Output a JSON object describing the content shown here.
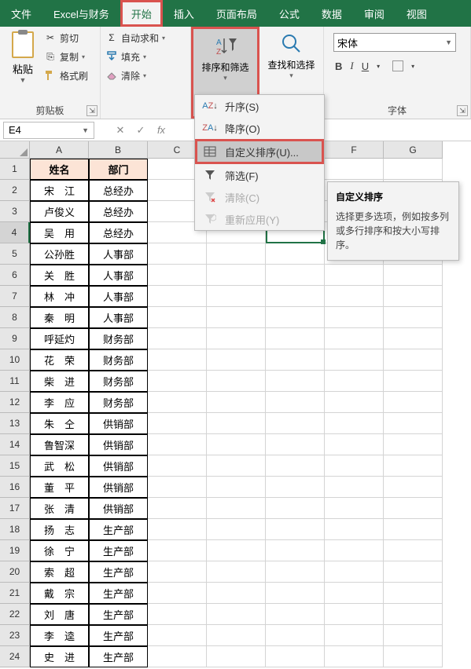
{
  "menubar": {
    "items": [
      "文件",
      "Excel与财务",
      "开始",
      "插入",
      "页面布局",
      "公式",
      "数据",
      "审阅",
      "视图"
    ],
    "active_index": 2
  },
  "ribbon": {
    "clipboard": {
      "paste": "粘贴",
      "cut": "剪切",
      "copy": "复制",
      "format_painter": "格式刷",
      "group_label": "剪贴板"
    },
    "editing": {
      "autosum": "自动求和",
      "fill": "填充",
      "clear": "清除"
    },
    "sort": {
      "label": "排序和筛选"
    },
    "find": {
      "label": "查找和选择"
    },
    "font": {
      "name": "宋体",
      "group_label": "字体",
      "bold": "B",
      "italic": "I",
      "underline": "U"
    }
  },
  "formula_bar": {
    "cell_ref": "E4"
  },
  "columns": [
    "A",
    "B",
    "C",
    "D",
    "E",
    "F",
    "G"
  ],
  "table": {
    "headers": [
      "姓名",
      "部门"
    ],
    "rows": [
      [
        "宋　江",
        "总经办"
      ],
      [
        "卢俊义",
        "总经办"
      ],
      [
        "吴　用",
        "总经办"
      ],
      [
        "公孙胜",
        "人事部"
      ],
      [
        "关　胜",
        "人事部"
      ],
      [
        "林　冲",
        "人事部"
      ],
      [
        "秦　明",
        "人事部"
      ],
      [
        "呼延灼",
        "财务部"
      ],
      [
        "花　荣",
        "财务部"
      ],
      [
        "柴　进",
        "财务部"
      ],
      [
        "李　应",
        "财务部"
      ],
      [
        "朱　仝",
        "供销部"
      ],
      [
        "鲁智深",
        "供销部"
      ],
      [
        "武　松",
        "供销部"
      ],
      [
        "董　平",
        "供销部"
      ],
      [
        "张　清",
        "供销部"
      ],
      [
        "扬　志",
        "生产部"
      ],
      [
        "徐　宁",
        "生产部"
      ],
      [
        "索　超",
        "生产部"
      ],
      [
        "戴　宗",
        "生产部"
      ],
      [
        "刘　唐",
        "生产部"
      ],
      [
        "李　逵",
        "生产部"
      ],
      [
        "史　进",
        "生产部"
      ]
    ]
  },
  "row_count": 24,
  "active_row": 4,
  "dropdown": {
    "sort_asc": "升序(S)",
    "sort_desc": "降序(O)",
    "custom_sort": "自定义排序(U)...",
    "filter": "筛选(F)",
    "clear": "清除(C)",
    "reapply": "重新应用(Y)"
  },
  "tooltip": {
    "title": "自定义排序",
    "body": "选择更多选项，例如按多列或多行排序和按大小写排序。"
  }
}
